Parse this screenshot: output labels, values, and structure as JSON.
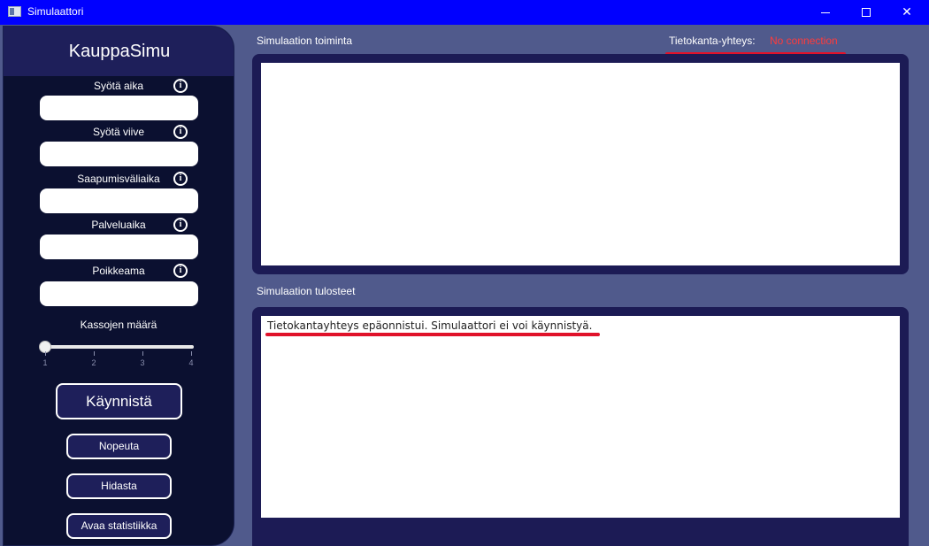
{
  "window": {
    "title": "Simulaattori",
    "minimize_glyph": "",
    "maximize_glyph": "",
    "close_glyph": "✕"
  },
  "sidebar": {
    "brand": "KauppaSimu",
    "fields": [
      {
        "label": "Syötä aika",
        "value": ""
      },
      {
        "label": "Syötä viive",
        "value": ""
      },
      {
        "label": "Saapumisväliaika",
        "value": ""
      },
      {
        "label": "Palveluaika",
        "value": ""
      },
      {
        "label": "Poikkeama",
        "value": ""
      }
    ],
    "info_glyph": "i",
    "slider": {
      "label": "Kassojen määrä",
      "value": 1,
      "min": 1,
      "max": 4,
      "ticks": [
        "1",
        "2",
        "3",
        "4"
      ]
    },
    "buttons": {
      "start": "Käynnistä",
      "speed_up": "Nopeuta",
      "slow_down": "Hidasta",
      "statistics": "Avaa statistiikka"
    }
  },
  "main": {
    "activity_label": "Simulaation toiminta",
    "db_label": "Tietokanta-yhteys:",
    "db_status": "No connection",
    "output_label": "Simulaation tulosteet",
    "output_text": "Tietokantayhteys epäonnistui. Simulaattori ei voi käynnistyä."
  },
  "colors": {
    "titlebar": "#0000ff",
    "background": "#505a8c",
    "sidebar": "#0b1030",
    "accent": "#1e1f5a",
    "error": "#ff3b3b"
  }
}
